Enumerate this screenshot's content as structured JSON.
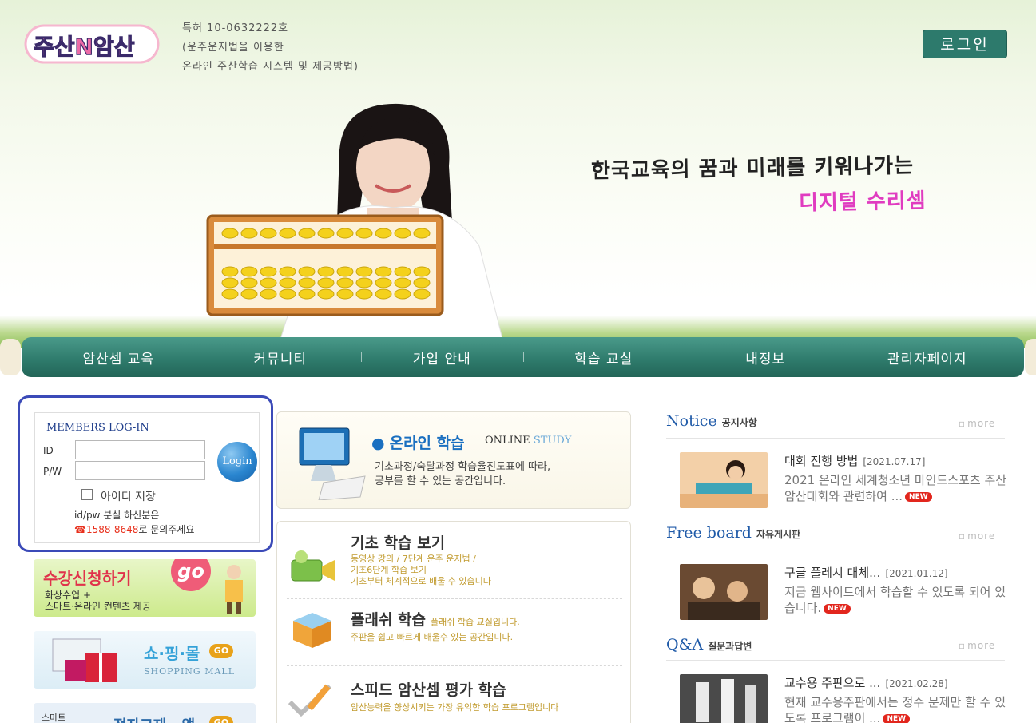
{
  "header": {
    "logo_text": "주산N암산",
    "patent_lines": [
      "특허 10-0632222호",
      "(운주운지법을 이용한",
      "온라인 주산학습 시스템 및 제공방법)"
    ],
    "login_button": "로그인",
    "slogan_line1": "한국교육의 꿈과 미래를 키워나가는",
    "slogan_line2": "디지털 수리셈"
  },
  "nav": {
    "items": [
      {
        "label": "암산셈 교육"
      },
      {
        "label": "커뮤니티"
      },
      {
        "label": "가입 안내"
      },
      {
        "label": "학습 교실"
      },
      {
        "label": "내정보"
      },
      {
        "label": "관리자페이지"
      }
    ]
  },
  "login_box": {
    "title": "MEMBERS  LOG-IN",
    "id_label": "ID",
    "pw_label": "P/W",
    "id_value": "",
    "pw_value": "",
    "submit_label": "Login",
    "remember_label": "아이디 저장",
    "lost_line1": "id/pw 분실 하신분은",
    "lost_phone": "☎1588-8648",
    "lost_line2_suffix": "로 문의주세요"
  },
  "banners": {
    "apply": {
      "title": "수강신청하기",
      "go": "go",
      "sub1": "화상수업 +",
      "sub2": "스마트·온라인 컨텐츠 제공"
    },
    "shop": {
      "title": "쇼·핑·몰",
      "badge": "GO",
      "sub": "SHOPPING MALL"
    },
    "smart": {
      "small": "스마트",
      "title": "전자교재 · 앱",
      "badge": "GO"
    }
  },
  "online_study": {
    "title": "온라인 학습",
    "en_a": "ONLINE",
    "en_b": "STUDY",
    "desc1": "기초과정/숙달과정 학습율진도표에 따라,",
    "desc2": "공부를 할 수 있는 공간입니다."
  },
  "study_list": [
    {
      "title": "기초 학습 보기",
      "sub": "",
      "desc1": "동영상 강의 / 7단계 운주 운지법 /",
      "desc2": "기초6단계 학습 보기",
      "desc3": "기초부터 체계적으로 배울 수 있습니다"
    },
    {
      "title": "플래쉬 학습",
      "sub": "플래쉬 학습 교실입니다.",
      "desc1": "주판을 쉽고 빠르게 배울수 있는 공간입니다.",
      "desc2": "",
      "desc3": ""
    },
    {
      "title": "스피드 암산셈 평가 학습",
      "sub": "",
      "desc1": "암산능력을 향상시키는 가장 유익한 학습 프로그램입니다",
      "desc2": "",
      "desc3": ""
    }
  ],
  "notice": {
    "title": "Notice",
    "title_ko": "공지사항",
    "more": "more",
    "post_title": "대회 진행 방법",
    "post_date": "[2021.07.17]",
    "post_text": "2021 온라인 세계청소년 마인드스포츠 주산암산대회와 관련하여 ...",
    "badge": "NEW"
  },
  "freeboard": {
    "title": "Free board",
    "title_ko": "자유게시판",
    "more": "more",
    "post_title": "구글 플레시 대체...",
    "post_date": "[2021.01.12]",
    "post_text": "지금 웹사이트에서 학습할 수 있도록 되어 있습니다.",
    "badge": "NEW"
  },
  "qna": {
    "title": "Q&A",
    "title_ko": "질문과답변",
    "more": "more",
    "post_title": "교수용 주판으로 ...",
    "post_date": "[2021.02.28]",
    "post_text": "현재 교수용주판에서는 정수 문제만 할 수 있도록 프로그램이 ...",
    "badge": "NEW"
  },
  "colors": {
    "nav": "#2f7c6d",
    "login_border": "#3b4ab8",
    "accent_blue": "#1a6fc0",
    "magenta": "#e03cc0"
  }
}
